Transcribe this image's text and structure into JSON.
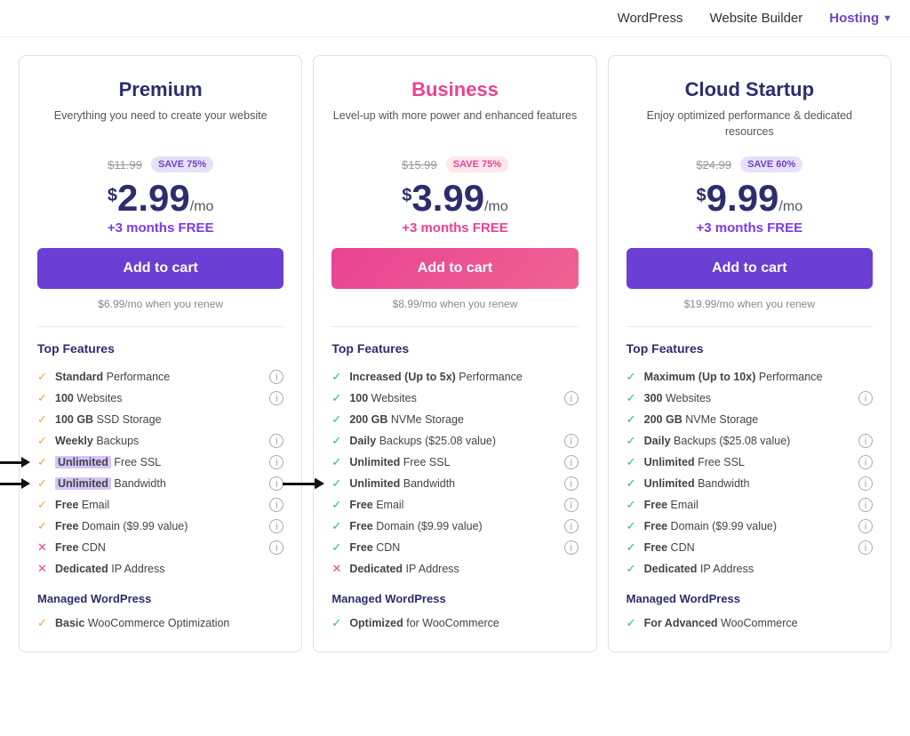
{
  "navbar": {
    "items": [
      {
        "label": "WordPress",
        "active": false
      },
      {
        "label": "Website Builder",
        "active": false
      },
      {
        "label": "Hosting",
        "active": true
      }
    ]
  },
  "plans": [
    {
      "id": "premium",
      "name": "Premium",
      "desc": "Everything you need to create your website",
      "original_price": "$11.99",
      "save_badge": "SAVE 75%",
      "save_badge_type": "purple",
      "price_dollars": "2",
      "price_cents": "99",
      "price_period": "/mo",
      "free_months": "+3 months FREE",
      "free_months_color": "purple",
      "add_to_cart": "Add to cart",
      "btn_type": "purple",
      "renew_price": "$6.99/mo when you renew",
      "features_title": "Top Features",
      "features": [
        {
          "icon": "check-yellow",
          "text_bold": "Standard",
          "text": " Performance",
          "info": true
        },
        {
          "icon": "check-yellow",
          "text_bold": "100",
          "text": " Websites",
          "info": true
        },
        {
          "icon": "check-yellow",
          "text_bold": "100 GB",
          "text": " SSD Storage",
          "info": false
        },
        {
          "icon": "check-yellow",
          "text_bold": "Weekly",
          "text": " Backups",
          "info": true
        },
        {
          "icon": "check-yellow",
          "text_bold": "Unlimited",
          "text": " Free SSL",
          "info": true,
          "highlight": true
        },
        {
          "icon": "check-yellow",
          "text_bold": "Unlimited",
          "text": " Bandwidth",
          "info": true,
          "highlight": true
        },
        {
          "icon": "check-yellow",
          "text_bold": "Free",
          "text": " Email",
          "info": true
        },
        {
          "icon": "check-yellow",
          "text_bold": "Free",
          "text": " Domain ($9.99 value)",
          "info": true
        },
        {
          "icon": "x",
          "text_bold": "Free",
          "text": " CDN",
          "info": true
        },
        {
          "icon": "x",
          "text_bold": "Dedicated",
          "text": " IP Address",
          "info": false
        }
      ],
      "managed_title": "Managed WordPress",
      "managed_features": [
        {
          "icon": "check-yellow",
          "text_bold": "Basic",
          "text": " WooCommerce Optimization",
          "info": false
        }
      ]
    },
    {
      "id": "business",
      "name": "Business",
      "desc": "Level-up with more power and enhanced features",
      "original_price": "$15.99",
      "save_badge": "SAVE 75%",
      "save_badge_type": "pink",
      "price_dollars": "3",
      "price_cents": "99",
      "price_period": "/mo",
      "free_months": "+3 months FREE",
      "free_months_color": "pink",
      "add_to_cart": "Add to cart",
      "btn_type": "pink",
      "renew_price": "$8.99/mo when you renew",
      "features_title": "Top Features",
      "features": [
        {
          "icon": "check-green",
          "text_bold": "Increased (Up to 5x)",
          "text": " Performance",
          "info": false
        },
        {
          "icon": "check-green",
          "text_bold": "100",
          "text": " Websites",
          "info": true
        },
        {
          "icon": "check-green",
          "text_bold": "200 GB",
          "text": " NVMe Storage",
          "info": false
        },
        {
          "icon": "check-green",
          "text_bold": "Daily",
          "text": " Backups ($25.08 value)",
          "info": true
        },
        {
          "icon": "check-green",
          "text_bold": "Unlimited",
          "text": " Free SSL",
          "info": true
        },
        {
          "icon": "check-green",
          "text_bold": "Unlimited",
          "text": " Bandwidth",
          "info": true,
          "arrow": true
        },
        {
          "icon": "check-green",
          "text_bold": "Free",
          "text": " Email",
          "info": true
        },
        {
          "icon": "check-green",
          "text_bold": "Free",
          "text": " Domain ($9.99 value)",
          "info": true
        },
        {
          "icon": "check-green",
          "text_bold": "Free",
          "text": " CDN",
          "info": true
        },
        {
          "icon": "x",
          "text_bold": "Dedicated",
          "text": " IP Address",
          "info": false
        }
      ],
      "managed_title": "Managed WordPress",
      "managed_features": [
        {
          "icon": "check-green",
          "text_bold": "Optimized",
          "text": " for WooCommerce",
          "info": false
        }
      ]
    },
    {
      "id": "cloud-startup",
      "name": "Cloud Startup",
      "desc": "Enjoy optimized performance & dedicated resources",
      "original_price": "$24.99",
      "save_badge": "SAVE 60%",
      "save_badge_type": "purple",
      "price_dollars": "9",
      "price_cents": "99",
      "price_period": "/mo",
      "free_months": "+3 months FREE",
      "free_months_color": "purple",
      "add_to_cart": "Add to cart",
      "btn_type": "purple",
      "renew_price": "$19.99/mo when you renew",
      "features_title": "Top Features",
      "features": [
        {
          "icon": "check-green",
          "text_bold": "Maximum (Up to 10x)",
          "text": " Performance",
          "info": false
        },
        {
          "icon": "check-green",
          "text_bold": "300",
          "text": " Websites",
          "info": true
        },
        {
          "icon": "check-green",
          "text_bold": "200 GB",
          "text": " NVMe Storage",
          "info": false
        },
        {
          "icon": "check-green",
          "text_bold": "Daily",
          "text": " Backups ($25.08 value)",
          "info": true
        },
        {
          "icon": "check-green",
          "text_bold": "Unlimited",
          "text": " Free SSL",
          "info": true
        },
        {
          "icon": "check-green",
          "text_bold": "Unlimited",
          "text": " Bandwidth",
          "info": true
        },
        {
          "icon": "check-green",
          "text_bold": "Free",
          "text": " Email",
          "info": true
        },
        {
          "icon": "check-green",
          "text_bold": "Free",
          "text": " Domain ($9.99 value)",
          "info": true
        },
        {
          "icon": "check-green",
          "text_bold": "Free",
          "text": " CDN",
          "info": true
        },
        {
          "icon": "check-green",
          "text_bold": "Dedicated",
          "text": " IP Address",
          "info": false
        }
      ],
      "managed_title": "Managed WordPress",
      "managed_features": [
        {
          "icon": "check-green",
          "text_bold": "For Advanced",
          "text": " WooCommerce",
          "info": false
        }
      ]
    }
  ]
}
